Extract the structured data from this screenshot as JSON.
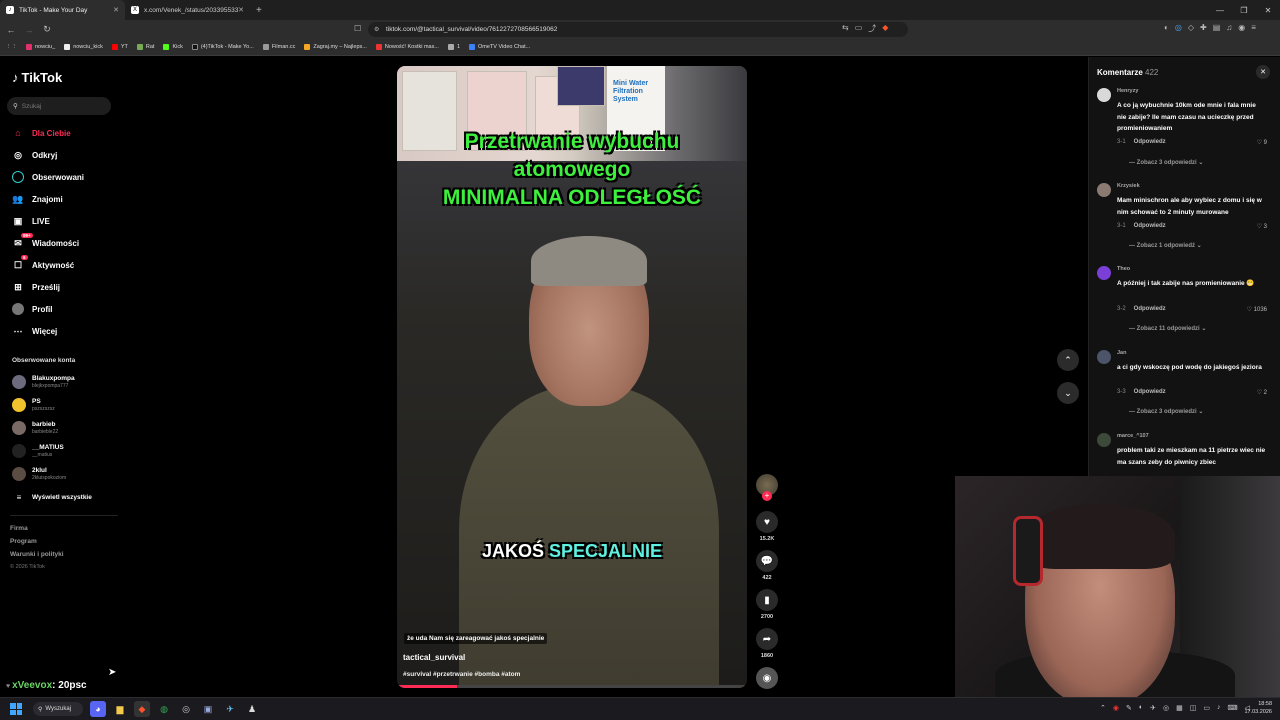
{
  "browser": {
    "tabs": [
      {
        "title": "TikTok - Make Your Day",
        "active": true
      },
      {
        "title": "x.com/Venek_/status/203395533761",
        "active": false
      }
    ],
    "url": "tiktok.com/@tactical_survival/video/7612272708566519062",
    "bookmarks": [
      "nowciu_",
      "nowciu_kick",
      "YT",
      "Rat",
      "Kick",
      "(4)TikTok - Make Yo...",
      "Filman.cc",
      "Zagraj.my – Najleps...",
      "Nowość! Kostki mas...",
      "1",
      "OmeTV Video Chat..."
    ]
  },
  "sidebar": {
    "logo": "TikTok",
    "search_placeholder": "Szukaj",
    "nav": [
      {
        "label": "Dla Ciebie",
        "icon": "home-icon",
        "active": true
      },
      {
        "label": "Odkryj",
        "icon": "compass-icon"
      },
      {
        "label": "Obserwowani",
        "icon": "following-icon"
      },
      {
        "label": "Znajomi",
        "icon": "friends-icon"
      },
      {
        "label": "LIVE",
        "icon": "live-icon"
      },
      {
        "label": "Wiadomości",
        "icon": "messages-icon",
        "badge": "99+"
      },
      {
        "label": "Aktywność",
        "icon": "activity-icon",
        "badge": "6"
      },
      {
        "label": "Prześlij",
        "icon": "upload-icon"
      },
      {
        "label": "Profil",
        "icon": "profile-icon"
      },
      {
        "label": "Więcej",
        "icon": "more-icon"
      }
    ],
    "followed_title": "Obserwowane konta",
    "followed": [
      {
        "name": "Blakuxpompa",
        "handle": "blejkxpompa777",
        "color": "#6b6b7d"
      },
      {
        "name": "PS",
        "handle": "pszszszsz",
        "color": "#f2c12e"
      },
      {
        "name": "barbieb",
        "handle": "barbieble22",
        "color": "#7a6a66"
      },
      {
        "name": "__MATIUS",
        "handle": "__matius",
        "color": "#222222"
      },
      {
        "name": "2klul",
        "handle": "2kluispokoziom",
        "color": "#5b4c44"
      }
    ],
    "show_all": "Wyświetl wszystkie",
    "footer": [
      "Firma",
      "Program",
      "Warunki i polityki"
    ],
    "copyright": "© 2026 TikTok"
  },
  "video": {
    "caption_top_1": "Przetrwanie wybuchu",
    "caption_top_2": "atomowego",
    "caption_top_3": "MINIMALNA ODLEGŁOŚĆ",
    "caption_mid_a": "JAKOŚ",
    "caption_mid_b": "SPECJALNIE",
    "subtitle": "że uda Nam się zareagować jakoś specjalnie",
    "author": "tactical_survival",
    "tags": "#survival #przetrwanie #bomba #atom",
    "shelf_text": "Mini Water Filtration System",
    "progress": 0.17
  },
  "actions": {
    "likes": "15.2K",
    "comments": "422",
    "saves": "2700",
    "shares": "1860"
  },
  "comments_panel": {
    "title": "Komentarze",
    "count": "422",
    "items": [
      {
        "user": "Henryzy",
        "text": "A co ją wybuchnie 10km ode mnie i fala mnie nie zabije? Ile mam czasu na ucieczkę przed promieniowaniem",
        "date": "3-1",
        "reply": "Odpowiedz",
        "likes": "9",
        "more": "Zobacz 3 odpowiedzi",
        "color": "#d9d9d9"
      },
      {
        "user": "Krzysiek",
        "text": "Mam minischron ale aby wybiec z domu i się w nim schować to 2 minuty murowane",
        "date": "3-1",
        "reply": "Odpowiedz",
        "likes": "3",
        "more": "Zobacz 1 odpowiedź",
        "color": "#8a7a72"
      },
      {
        "user": "Theo",
        "text": "A później i tak zabije nas promieniowanie 😬",
        "date": "3-2",
        "reply": "Odpowiedz",
        "likes": "1036",
        "more": "Zobacz 11 odpowiedzi",
        "color": "#7a3fd6"
      },
      {
        "user": "Jan",
        "text": "a ci gdy wskoczę pod wodę do jakiegoś jeziora",
        "date": "3-3",
        "reply": "Odpowiedz",
        "likes": "2",
        "more": "Zobacz 3 odpowiedzi",
        "color": "#4b5468"
      },
      {
        "user": "marce_^107",
        "text": "problem taki ze mieszkam na 11 pietrze wiec nie ma szans zeby do piwnicy zbiec",
        "date": "",
        "reply": "",
        "likes": "",
        "more": "",
        "color": "#3d4a3a"
      }
    ]
  },
  "chat": {
    "user": "xVeevox",
    "message": ": 20psc"
  },
  "taskbar": {
    "search": "Wyszukaj",
    "time": "18:58",
    "date": "17.03.2026"
  }
}
